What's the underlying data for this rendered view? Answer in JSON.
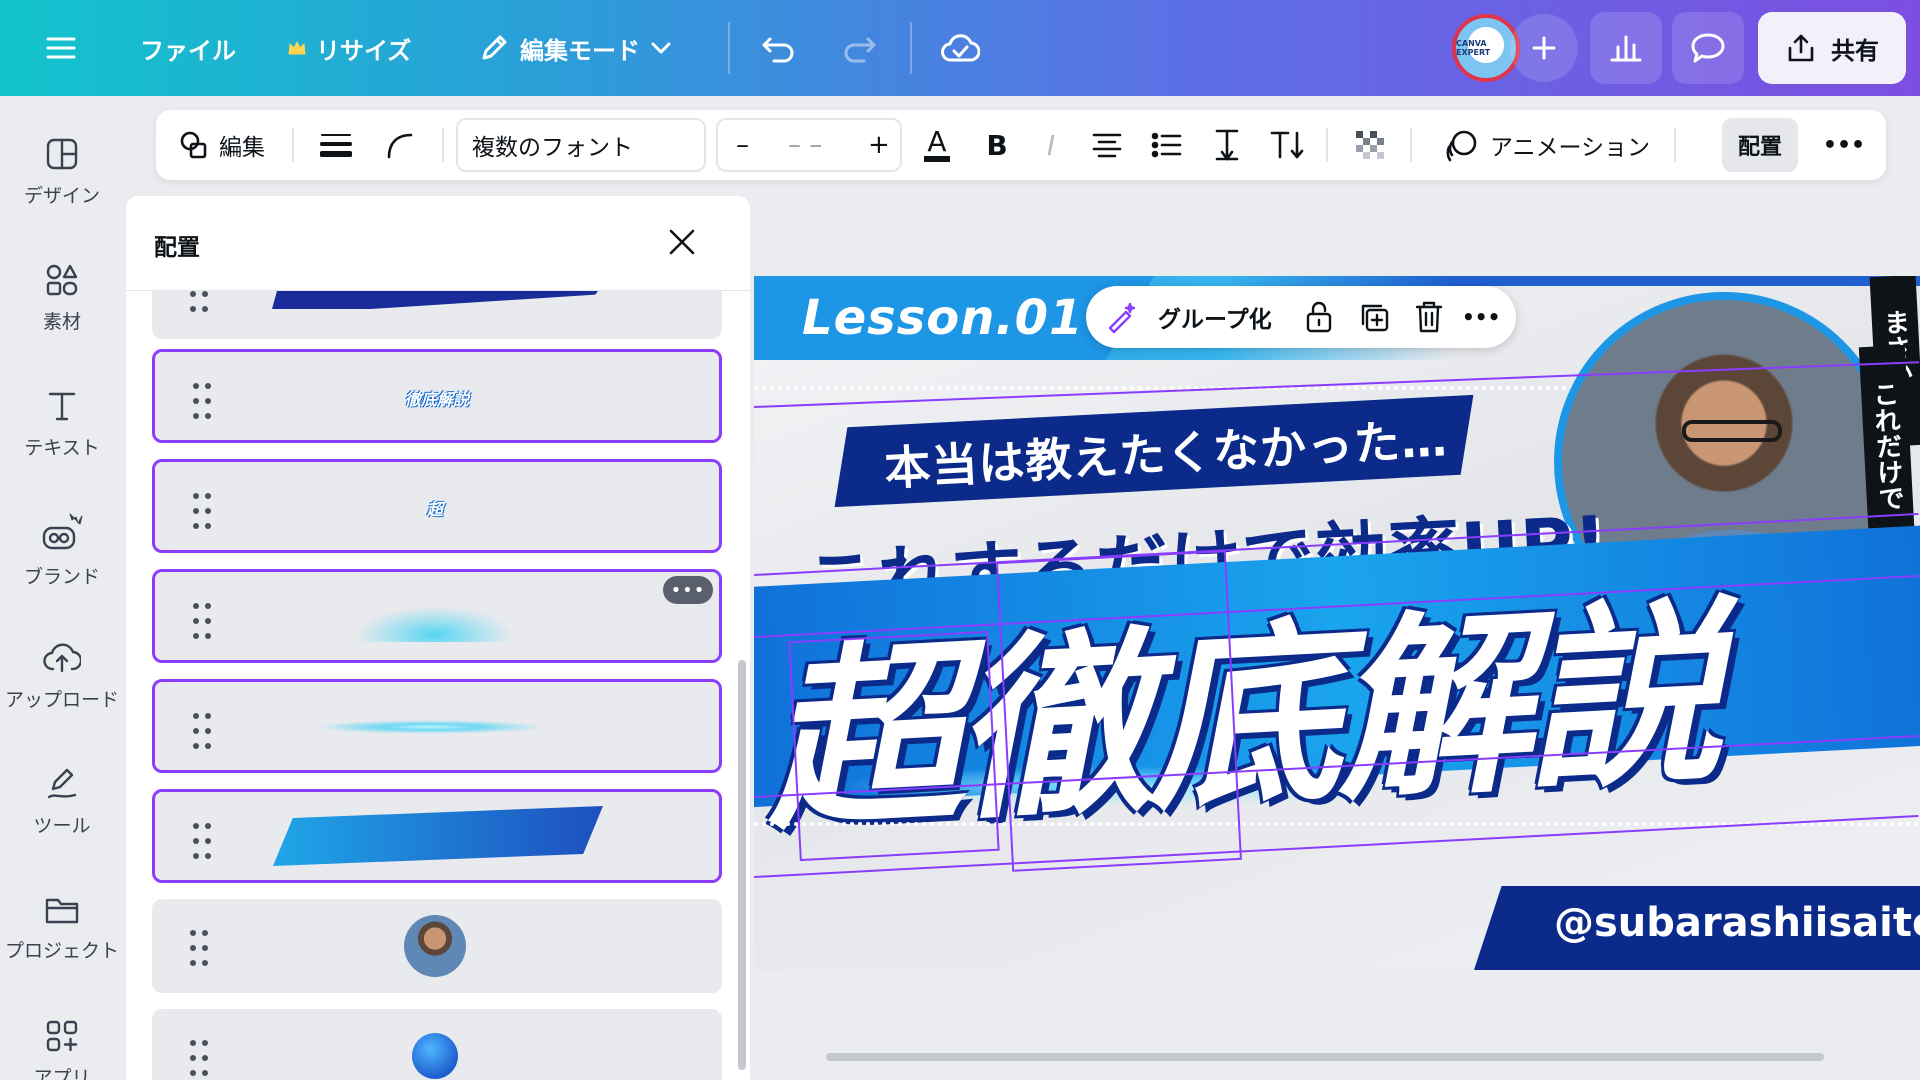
{
  "topbar": {
    "file": "ファイル",
    "resize": "リサイズ",
    "edit_mode": "編集モード",
    "share": "共有",
    "avatar_text": "CANVA EXPERT"
  },
  "rail": {
    "items": [
      {
        "label": "デザイン",
        "icon": "layout-icon"
      },
      {
        "label": "素材",
        "icon": "elements-icon"
      },
      {
        "label": "テキスト",
        "icon": "text-icon"
      },
      {
        "label": "ブランド",
        "icon": "brand-icon"
      },
      {
        "label": "アップロード",
        "icon": "upload-icon"
      },
      {
        "label": "ツール",
        "icon": "draw-icon"
      },
      {
        "label": "プロジェクト",
        "icon": "folder-icon"
      },
      {
        "label": "アプリ",
        "icon": "apps-icon"
      }
    ]
  },
  "toolbar": {
    "edit": "編集",
    "font": "複数のフォント",
    "size_minus": "–",
    "size_value": "– –",
    "size_plus": "+",
    "bold": "B",
    "italic": "I",
    "animation": "アニメーション",
    "position": "配置",
    "more": "•••"
  },
  "panel": {
    "title": "配置",
    "layers": [
      {
        "kind": "shape-dark",
        "selected": false
      },
      {
        "kind": "text",
        "label": "徹底解説",
        "selected": true
      },
      {
        "kind": "text",
        "label": "超",
        "selected": true
      },
      {
        "kind": "glow-burst",
        "selected": true,
        "more": "•••"
      },
      {
        "kind": "glow-line",
        "selected": true
      },
      {
        "kind": "shape-gradient",
        "selected": true
      },
      {
        "kind": "photo",
        "selected": false
      },
      {
        "kind": "circle",
        "selected": false
      }
    ]
  },
  "canvas": {
    "lesson": "Lesson.01",
    "line1": "本当は教えたくなかった…",
    "line2": "これするだけで効率UP!",
    "big_text": "超徹底解説",
    "handle": "@subarashiisaito",
    "vertical1": "これだけで",
    "vertical2": "まさか…"
  },
  "context_menu": {
    "group": "グループ化",
    "more": "•••"
  },
  "colors": {
    "accent": "#8b3dff",
    "navy": "#0b2a8a",
    "blue": "#1e96e6"
  }
}
